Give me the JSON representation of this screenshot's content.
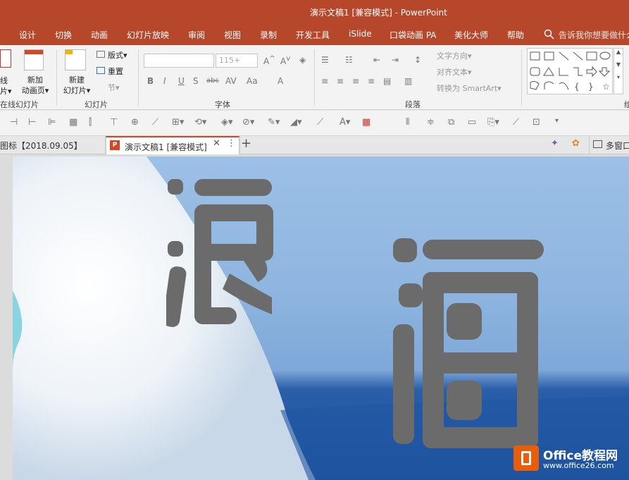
{
  "window": {
    "title": "演示文稿1 [兼容模式]  -  PowerPoint"
  },
  "menu": [
    "设计",
    "切换",
    "动画",
    "幻灯片放映",
    "审阅",
    "视图",
    "录制",
    "开发工具",
    "iSlide",
    "口袋动画 PA",
    "美化大师",
    "帮助"
  ],
  "tell_me": "告诉我你想要做什么",
  "ribbon": {
    "left_partial": [
      "线",
      "片▾",
      "在线幻灯片"
    ],
    "new_page": "新加\n动画页▾",
    "new_slide": "新建\n幻灯片▾",
    "layout": "版式▾",
    "reset": "重置",
    "section": "节▾",
    "group_slides": "幻灯片",
    "font_size": "115+",
    "group_font": "字体",
    "text_direction": "文字方向▾",
    "align_text": "对齐文本▾",
    "smartart": "转换为 SmartArt▾",
    "group_paragraph": "段落",
    "group_drawing_partial": "绘"
  },
  "tabs": {
    "left_tab": "图标【2018.09.05】",
    "active_tab": "演示文稿1 [兼容模式]",
    "right_label": "多窗口"
  },
  "slide": {
    "char1": "浪",
    "char2": "涌"
  },
  "watermark": {
    "brand": "Office教程网",
    "url": "www.office26.com"
  },
  "colors": {
    "accent": "#b7472a",
    "char_fill": "#6b6b6b",
    "sky": "#8fb6e0",
    "sea": "#1e4f99"
  },
  "icons": [
    "search-icon",
    "close-icon",
    "add-tab-icon",
    "more-icon",
    "ppt-file-icon"
  ]
}
